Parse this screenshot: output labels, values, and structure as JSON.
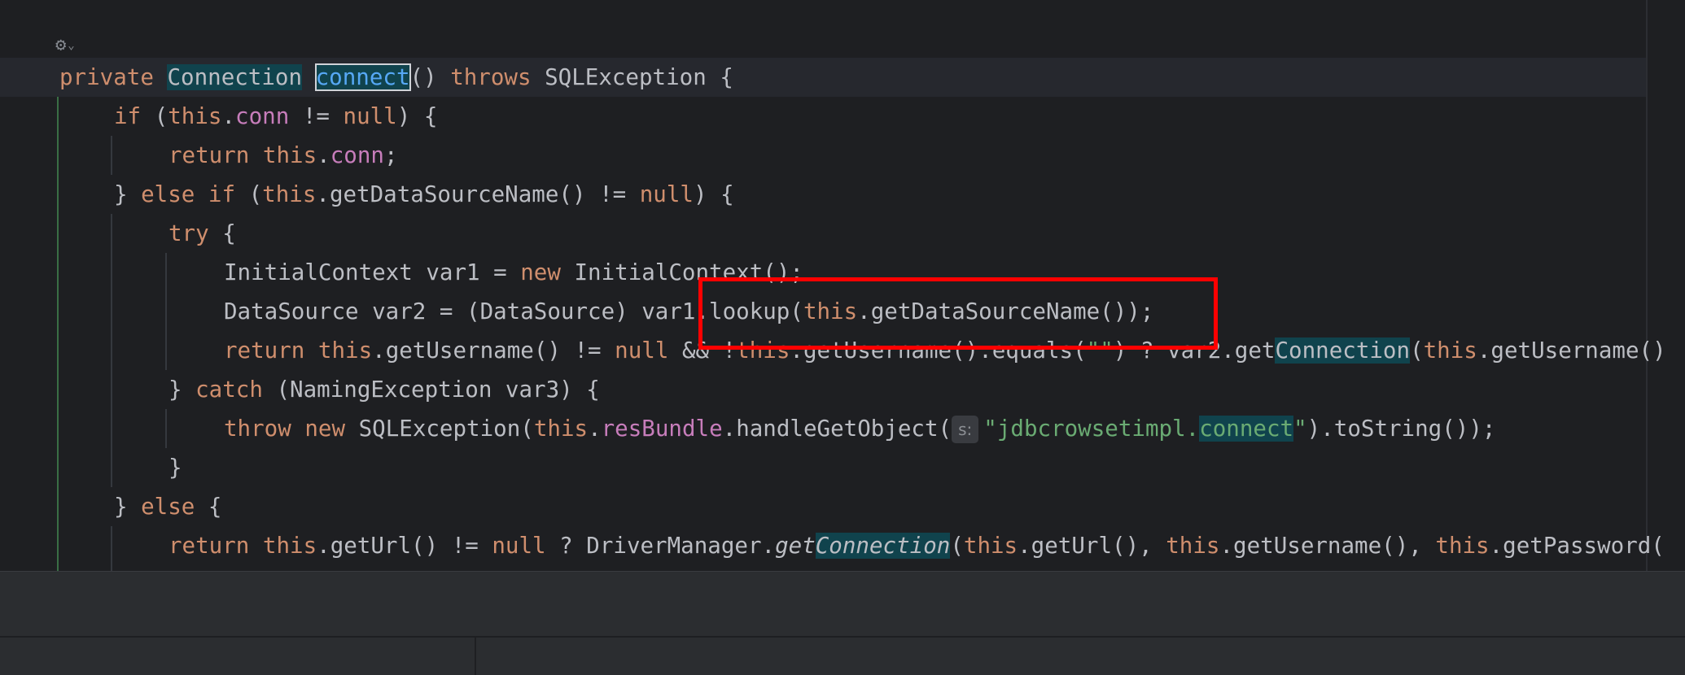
{
  "editor": {
    "language": "java",
    "method_name": "connect",
    "lines": [
      {
        "id": "l1",
        "tokens": [
          {
            "t": "private",
            "k": "kw"
          },
          {
            "t": " "
          },
          {
            "t": "Connection",
            "k": "hl"
          },
          {
            "t": " "
          },
          {
            "t": "connect",
            "k": "cur"
          },
          {
            "t": "() "
          },
          {
            "t": "throws",
            "k": "kw"
          },
          {
            "t": " SQLException {"
          }
        ]
      },
      {
        "id": "l2",
        "tokens": [
          {
            "t": "if",
            "k": "kw"
          },
          {
            "t": " ("
          },
          {
            "t": "this",
            "k": "kw"
          },
          {
            "t": "."
          },
          {
            "t": "conn",
            "k": "fld"
          },
          {
            "t": " != "
          },
          {
            "t": "null",
            "k": "kw"
          },
          {
            "t": ") {"
          }
        ]
      },
      {
        "id": "l3",
        "tokens": [
          {
            "t": "return",
            "k": "kw"
          },
          {
            "t": " "
          },
          {
            "t": "this",
            "k": "kw"
          },
          {
            "t": "."
          },
          {
            "t": "conn",
            "k": "fld"
          },
          {
            "t": ";"
          }
        ]
      },
      {
        "id": "l4",
        "tokens": [
          {
            "t": "} "
          },
          {
            "t": "else if",
            "k": "kw"
          },
          {
            "t": " ("
          },
          {
            "t": "this",
            "k": "kw"
          },
          {
            "t": ".getDataSourceName() != "
          },
          {
            "t": "null",
            "k": "kw"
          },
          {
            "t": ") {"
          }
        ]
      },
      {
        "id": "l5",
        "tokens": [
          {
            "t": "try",
            "k": "kw"
          },
          {
            "t": " {"
          }
        ]
      },
      {
        "id": "l6",
        "tokens": [
          {
            "t": "InitialContext var1 = "
          },
          {
            "t": "new",
            "k": "kw"
          },
          {
            "t": " InitialContext();"
          }
        ]
      },
      {
        "id": "l7",
        "tokens": [
          {
            "t": "DataSource var2 = (DataSource) var1.lookup("
          },
          {
            "t": "this",
            "k": "kw"
          },
          {
            "t": ".getDataSourceName());"
          }
        ]
      },
      {
        "id": "l8",
        "tokens": [
          {
            "t": "return",
            "k": "kw"
          },
          {
            "t": " "
          },
          {
            "t": "this",
            "k": "kw"
          },
          {
            "t": ".getUsername() != "
          },
          {
            "t": "null",
            "k": "kw"
          },
          {
            "t": " && !"
          },
          {
            "t": "this",
            "k": "kw"
          },
          {
            "t": ".getUsername().equals("
          },
          {
            "t": "\"\"",
            "k": "str"
          },
          {
            "t": ") ? var2.get"
          },
          {
            "t": "Connection",
            "k": "hl"
          },
          {
            "t": "("
          },
          {
            "t": "this",
            "k": "kw"
          },
          {
            "t": ".getUsername()"
          }
        ]
      },
      {
        "id": "l9",
        "tokens": [
          {
            "t": "} "
          },
          {
            "t": "catch",
            "k": "kw"
          },
          {
            "t": " (NamingException var3) {"
          }
        ]
      },
      {
        "id": "l10",
        "tokens": [
          {
            "t": "throw",
            "k": "kw"
          },
          {
            "t": " "
          },
          {
            "t": "new",
            "k": "kw"
          },
          {
            "t": " SQLException("
          },
          {
            "t": "this",
            "k": "kw"
          },
          {
            "t": "."
          },
          {
            "t": "resBundle",
            "k": "fld"
          },
          {
            "t": ".handleGetObject("
          },
          {
            "t": "s:",
            "k": "hint"
          },
          {
            "t": "\"jdbcrowsetimpl.",
            "k": "str"
          },
          {
            "t": "connect",
            "k": "strhl"
          },
          {
            "t": "\"",
            "k": "str"
          },
          {
            "t": ").toString());"
          }
        ]
      },
      {
        "id": "l11",
        "tokens": [
          {
            "t": "}"
          }
        ]
      },
      {
        "id": "l12",
        "tokens": [
          {
            "t": "} "
          },
          {
            "t": "else",
            "k": "kw"
          },
          {
            "t": " {"
          }
        ]
      },
      {
        "id": "l13",
        "tokens": [
          {
            "t": "return",
            "k": "kw"
          },
          {
            "t": " "
          },
          {
            "t": "this",
            "k": "kw"
          },
          {
            "t": ".getUrl() != "
          },
          {
            "t": "null",
            "k": "kw"
          },
          {
            "t": " ? DriverManager."
          },
          {
            "t": "get",
            "k": "it"
          },
          {
            "t": "Connection",
            "k": "ithl"
          },
          {
            "t": "("
          },
          {
            "t": "this",
            "k": "kw"
          },
          {
            "t": ".getUrl(), "
          },
          {
            "t": "this",
            "k": "kw"
          },
          {
            "t": ".getUsername(), "
          },
          {
            "t": "this",
            "k": "kw"
          },
          {
            "t": ".getPassword("
          }
        ]
      }
    ]
  },
  "gutter": {
    "icon": "inlay-settings-icon",
    "chevron_icon": "chevron-down-icon"
  },
  "colors": {
    "background": "#1e1f22",
    "keyword": "#cf8e6d",
    "field": "#c77dbb",
    "string": "#6aab73",
    "usage_highlight": "#10434d",
    "annotation_box": "#ff0000"
  }
}
